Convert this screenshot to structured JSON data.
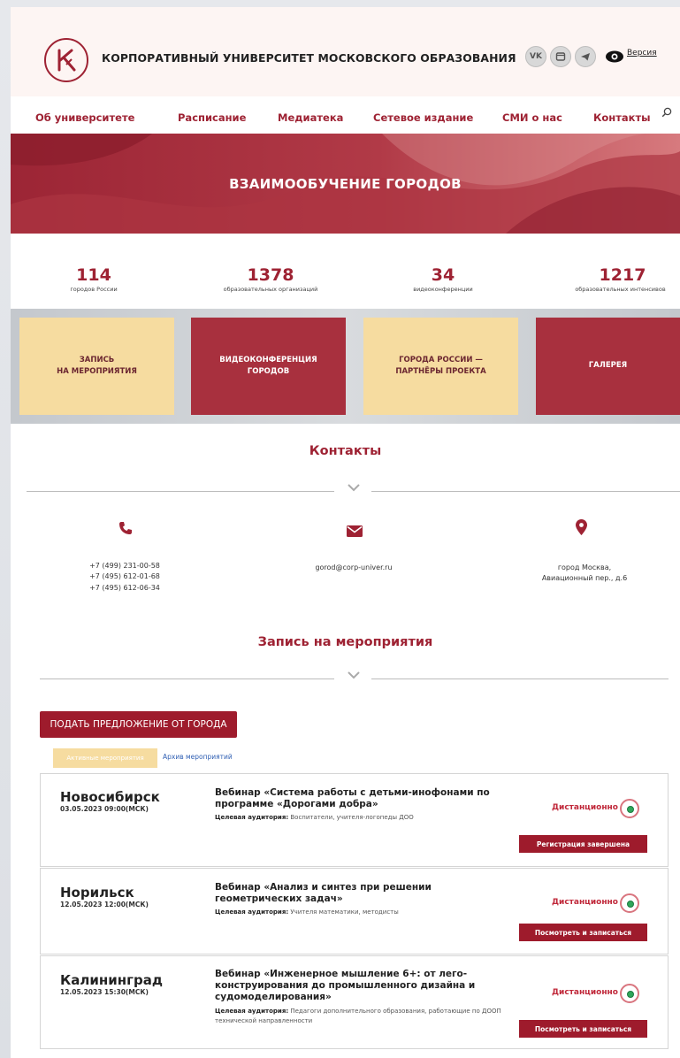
{
  "header": {
    "brand": "КОРПОРАТИВНЫЙ УНИВЕРСИТЕТ МОСКОВСКОГО ОБРАЗОВАНИЯ",
    "social": [
      "vk-icon",
      "window-icon",
      "telegram-icon"
    ],
    "version_label": "Версия",
    "accent_color": "#9e2233"
  },
  "nav": {
    "items": [
      "Об университете",
      "Расписание",
      "Медиатека",
      "Сетевое издание",
      "СМИ о нас",
      "Контакты"
    ]
  },
  "banner": {
    "title": "ВЗАИМООБУЧЕНИЕ ГОРОДОВ"
  },
  "stats": [
    {
      "value": "114",
      "label": "городов России"
    },
    {
      "value": "1378",
      "label": "образовательных организаций"
    },
    {
      "value": "34",
      "label": "видеоконференции"
    },
    {
      "value": "1217",
      "label": "образовательных интенсивов"
    }
  ],
  "tiles": [
    {
      "line1": "ЗАПИСЬ",
      "line2": "НА МЕРОПРИЯТИЯ"
    },
    {
      "line1": "ВИДЕОКОНФЕРЕНЦИЯ",
      "line2": "ГОРОДОВ"
    },
    {
      "line1": "ГОРОДА РОССИИ —",
      "line2": "ПАРТНЁРЫ ПРОЕКТА"
    },
    {
      "line1": "ГАЛЕРЕЯ",
      "line2": ""
    }
  ],
  "contacts": {
    "title": "Контакты",
    "phones": [
      "+7 (499) 231-00-58",
      "+7 (495) 612-01-68",
      "+7 (495) 612-06-34"
    ],
    "email": "gorod@corp-univer.ru",
    "address_line1": "город Москва,",
    "address_line2": "Авиационный пер., д.6"
  },
  "events": {
    "title": "Запись на мероприятия",
    "propose_button": "ПОДАТЬ ПРЕДЛОЖЕНИЕ ОТ ГОРОДА",
    "tab_active": "Активные мероприятия",
    "tab_archive": "Архив мероприятий",
    "audience_label": "Целевая аудитория:",
    "items": [
      {
        "city": "Новосибирск",
        "date": "03.05.2023 09:00(МСК)",
        "title": "Вебинар «Система работы с детьми-инофонами по программе «Дорогами добра»",
        "audience": "Воспитатели, учителя-логопеды ДОО",
        "mode": "Дистанционно",
        "button": "Регистрация завершена"
      },
      {
        "city": "Норильск",
        "date": "12.05.2023 12:00(МСК)",
        "title": "Вебинар «Анализ и синтез при решении геометрических задач»",
        "audience": "Учителя математики, методисты",
        "mode": "Дистанционно",
        "button": "Посмотреть и записаться"
      },
      {
        "city": "Калининград",
        "date": "12.05.2023 15:30(МСК)",
        "title": "Вебинар «Инженерное мышление 6+: от лего-конструирования до промышленного дизайна и судомоделирования»",
        "audience": "Педагоги дополнительного образования, работающие по ДООП технической направленности",
        "mode": "Дистанционно",
        "button": "Посмотреть и записаться"
      }
    ]
  }
}
